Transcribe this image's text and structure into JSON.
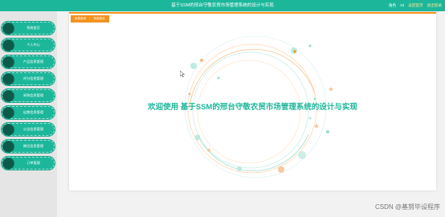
{
  "header": {
    "title": "基于SSM的邢台守敬农贸市场管理系统的设计与实现",
    "role_label": "角色",
    "username": "23",
    "back_label": "返回首页",
    "logout_label": "退出登录"
  },
  "sidebar": {
    "items": [
      {
        "label": "系统首页"
      },
      {
        "label": "个人中心"
      },
      {
        "label": "产品信息管理"
      },
      {
        "label": "评分信息管理"
      },
      {
        "label": "采购信息管理"
      },
      {
        "label": "出售信息管理"
      },
      {
        "label": "公告信息管理"
      },
      {
        "label": "摊位信息管理"
      },
      {
        "label": "订单管理"
      }
    ]
  },
  "breadcrumb": {
    "home": "系统首页",
    "separator": "/",
    "current": "系统首页"
  },
  "main": {
    "welcome": "欢迎使用 基于SSM的邢台守敬农贸市场管理系统的设计与实现"
  },
  "watermark": "CSDN @基努毕设程序",
  "colors": {
    "accent": "#1cb79b",
    "breadcrumb": "#f2931f",
    "sidebar_dot": "#0d5a4b"
  }
}
